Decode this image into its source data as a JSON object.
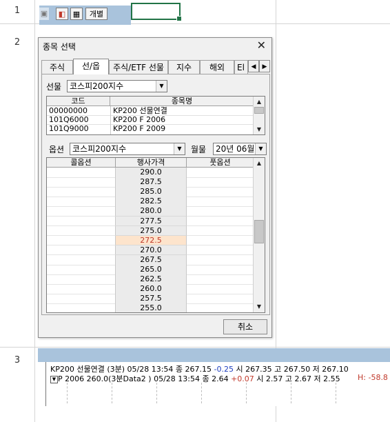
{
  "sheet": {
    "row_numbers": [
      "1",
      "2",
      "3"
    ]
  },
  "toolbar": {
    "button_label": "개별"
  },
  "dialog": {
    "title": "종목 선택",
    "tabs": [
      "주식",
      "선/옵",
      "주식/ETF 선물",
      "지수",
      "해외",
      "El"
    ],
    "active_tab": "선/옵",
    "futures": {
      "label": "선물",
      "selected": "코스피200지수",
      "columns": [
        "코드",
        "종목명"
      ],
      "rows": [
        {
          "code": "00000000",
          "name": "KP200 선물연결"
        },
        {
          "code": "101Q6000",
          "name": "KP200 F 2006"
        },
        {
          "code": "101Q9000",
          "name": "KP200 F 2009"
        }
      ]
    },
    "options": {
      "label": "옵션",
      "selected": "코스피200지수",
      "month_label": "월물",
      "month_selected": "20년 06월",
      "columns": [
        "콜옵션",
        "행사가격",
        "풋옵션"
      ],
      "strikes": [
        "290.0",
        "287.5",
        "285.0",
        "282.5",
        "280.0",
        "277.5",
        "275.0",
        "272.5",
        "270.0",
        "267.5",
        "265.0",
        "262.5",
        "260.0",
        "257.5",
        "255.0"
      ],
      "highlighted_strike": "272.5"
    },
    "cancel_label": "취소"
  },
  "chart": {
    "line1_prefix": "KP200 선물연결 (3분) 05/28 13:54   종 267.15 ",
    "line1_change": "-0.25",
    "line1_suffix": "  시 267.35 고 267.50 저 267.10",
    "line2_prefix": "P 2006 260.0(3분Data2 ) 05/28 13:54   종 2.64 ",
    "line2_change": "+0.07",
    "line2_suffix": "  시 2.57 고 2.67 저 2.55",
    "right_text": "H: -58.8",
    "colors": {
      "down": "#1f3fbf",
      "up": "#c0392b"
    }
  }
}
